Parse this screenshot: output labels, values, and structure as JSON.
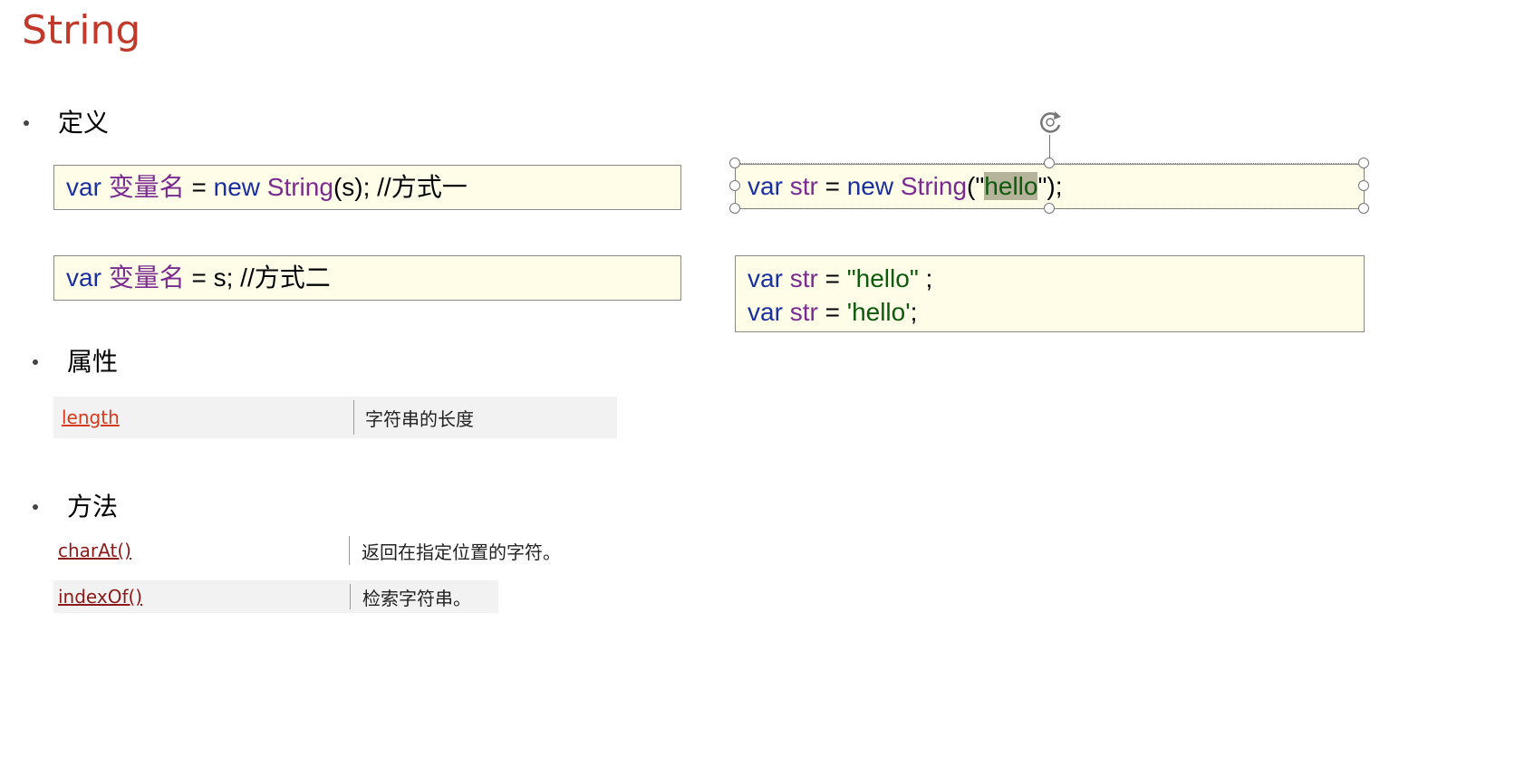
{
  "title": "String",
  "sections": {
    "definition": {
      "label": "定义"
    },
    "properties": {
      "label": "属性"
    },
    "methods": {
      "label": "方法"
    }
  },
  "code": {
    "way1": {
      "kw1": "var",
      "name": "变量名",
      "eq": " = ",
      "kw2": "new",
      "cls": "String",
      "rest": "(s); //方式一"
    },
    "way2": {
      "kw1": "var",
      "name": "变量名",
      "rest": " = s; //方式二"
    },
    "example1": {
      "kw1": "var",
      "var": "str",
      "eq": " = ",
      "kw2": "new",
      "cls": "String",
      "open": "(\"",
      "str_hl": "hello",
      "close": "\");"
    },
    "example2": {
      "line1": {
        "kw": "var",
        "var": "str",
        "eq": " = ",
        "str": "\"hello\"",
        "end": " ;"
      },
      "line2": {
        "kw": "var",
        "var": "str",
        "eq": " = ",
        "str": "'hello'",
        "end": ";"
      }
    }
  },
  "properties_table": [
    {
      "name": "length",
      "desc": "字符串的长度"
    }
  ],
  "methods_table": [
    {
      "name": "charAt()",
      "desc": "返回在指定位置的字符。"
    },
    {
      "name": "indexOf()",
      "desc": "检索字符串。"
    }
  ],
  "colors": {
    "title": "#c0392b",
    "code_bg": "#fffde8",
    "keyword": "#1a2fa0",
    "identifier": "#7a2b8f",
    "string": "#0d5a0d",
    "property_link": "#d63a1f",
    "method_link": "#8b1a1a"
  }
}
